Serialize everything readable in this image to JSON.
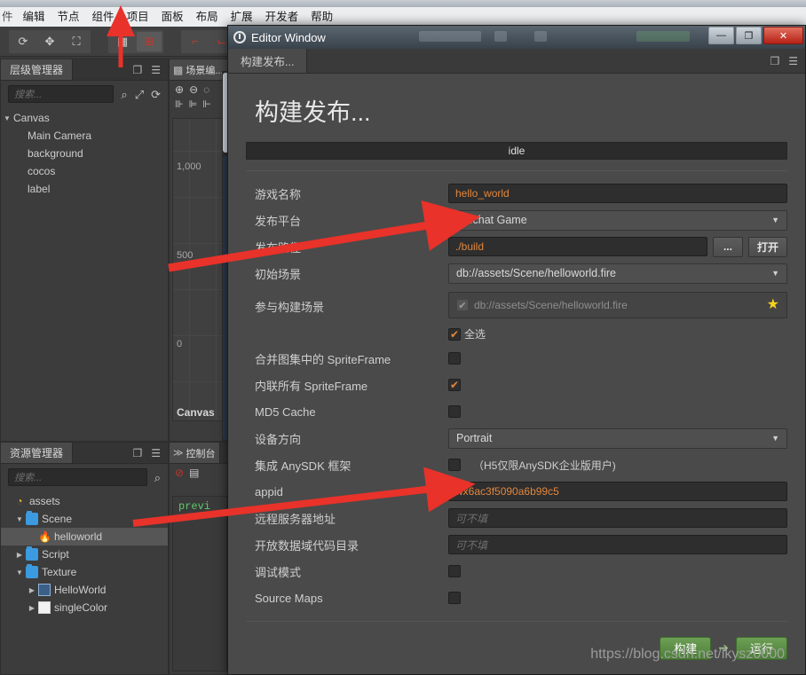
{
  "app": {
    "menubar": {
      "clipped_item": "件",
      "items": [
        "编辑",
        "节点",
        "组件",
        "项目",
        "面板",
        "布局",
        "扩展",
        "开发者",
        "帮助"
      ]
    },
    "toolbar": {
      "icons": [
        "refresh-icon",
        "move-icon",
        "scale-icon",
        "grid-icon",
        "gizmo-icon",
        "anchor-icon",
        "pivot-icon"
      ]
    }
  },
  "hierarchy_panel": {
    "tab_label": "层级管理器",
    "search_placeholder": "搜索...",
    "tree": [
      {
        "label": "Canvas",
        "depth": 0,
        "twisty": "▼"
      },
      {
        "label": "Main Camera",
        "depth": 1,
        "twisty": ""
      },
      {
        "label": "background",
        "depth": 1,
        "twisty": ""
      },
      {
        "label": "cocos",
        "depth": 1,
        "twisty": ""
      },
      {
        "label": "label",
        "depth": 1,
        "twisty": ""
      }
    ],
    "header_icons": [
      "popout-icon",
      "hamburger-icon"
    ],
    "tool_icons": [
      "search-icon",
      "expand-icon",
      "refresh-icon"
    ]
  },
  "assets_panel": {
    "tab_label": "资源管理器",
    "search_placeholder": "搜索...",
    "tree": [
      {
        "label": "assets",
        "depth": 0,
        "twisty": "",
        "icon": "assets-icon",
        "selected": false
      },
      {
        "label": "Scene",
        "depth": 1,
        "twisty": "▼",
        "icon": "folder-icon",
        "selected": false
      },
      {
        "label": "helloworld",
        "depth": 2,
        "twisty": "",
        "icon": "fire-icon",
        "selected": true
      },
      {
        "label": "Script",
        "depth": 1,
        "twisty": "▶",
        "icon": "folder-icon",
        "selected": false
      },
      {
        "label": "Texture",
        "depth": 1,
        "twisty": "▼",
        "icon": "folder-icon",
        "selected": false
      },
      {
        "label": "HelloWorld",
        "depth": 2,
        "twisty": "▶",
        "icon": "image-icon",
        "selected": false
      },
      {
        "label": "singleColor",
        "depth": 2,
        "twisty": "▶",
        "icon": "white-image-icon",
        "selected": false
      }
    ],
    "header_icons": [
      "popout-icon",
      "hamburger-icon"
    ],
    "tool_icons": [
      "search-icon"
    ]
  },
  "scene_panel": {
    "tab_label": "场景编...",
    "tool_icons": [
      "zoom-in-icon",
      "zoom-out-icon",
      "zoom-fit-icon",
      "align-left-icon",
      "align-center-icon",
      "align-right-icon"
    ],
    "ruler_labels": [
      "1,000",
      "500",
      "0"
    ],
    "canvas_label": "Canvas"
  },
  "console_panel": {
    "tab_label": "控制台",
    "tool_icons": [
      "clear-icon",
      "copy-icon"
    ],
    "log_text": "previ"
  },
  "editor_window": {
    "title": "Editor Window",
    "logo_icon": "cocos-logo-icon",
    "window_controls": {
      "minimize": "—",
      "maximize": "❐",
      "close": "✕"
    },
    "tab_label": "构建发布...",
    "tab_icons": [
      "popout-icon",
      "hamburger-icon"
    ],
    "page_title": "构建发布...",
    "status": "idle",
    "fields": {
      "game_name": {
        "label": "游戏名称",
        "value": "hello_world"
      },
      "platform": {
        "label": "发布平台",
        "value": "Wechat Game"
      },
      "build_path": {
        "label": "发布路径",
        "value": "./build",
        "browse_label": "...",
        "open_label": "打开"
      },
      "start_scene": {
        "label": "初始场景",
        "value": "db://assets/Scene/helloworld.fire"
      },
      "included_scenes": {
        "label": "参与构建场景",
        "items": [
          {
            "path": "db://assets/Scene/helloworld.fire",
            "checked": true,
            "starred": true
          }
        ],
        "select_all_label": "全选",
        "select_all_checked": true
      },
      "merge_spriteframe": {
        "label": "合并图集中的 SpriteFrame",
        "checked": false
      },
      "inline_spriteframe": {
        "label": "内联所有 SpriteFrame",
        "checked": true
      },
      "md5_cache": {
        "label": "MD5 Cache",
        "checked": false
      },
      "orientation": {
        "label": "设备方向",
        "value": "Portrait"
      },
      "anysdk": {
        "label": "集成 AnySDK 框架",
        "checked": false,
        "note": "（H5仅限AnySDK企业版用户)"
      },
      "appid": {
        "label": "appid",
        "value": "wx6ac3f5090a6b99c5"
      },
      "remote_server": {
        "label": "远程服务器地址",
        "value": "",
        "placeholder": "可不填"
      },
      "open_data_dir": {
        "label": "开放数据域代码目录",
        "value": "",
        "placeholder": "可不填"
      },
      "debug_mode": {
        "label": "调试模式",
        "checked": false
      },
      "source_maps": {
        "label": "Source Maps",
        "checked": false
      }
    },
    "footer": {
      "build_label": "构建",
      "arrow": "➔",
      "run_label": "运行"
    }
  },
  "watermark": "https://blog.csdn.net/lkysz0000",
  "annotations": {
    "color": "#e8322a",
    "arrows": [
      {
        "name": "arrow-to-menu-project",
        "desc": "points up to 项目 menu"
      },
      {
        "name": "arrow-to-platform-field",
        "desc": "points right to 发布平台 dropdown"
      },
      {
        "name": "arrow-to-appid-field",
        "desc": "points right to appid input"
      }
    ]
  }
}
